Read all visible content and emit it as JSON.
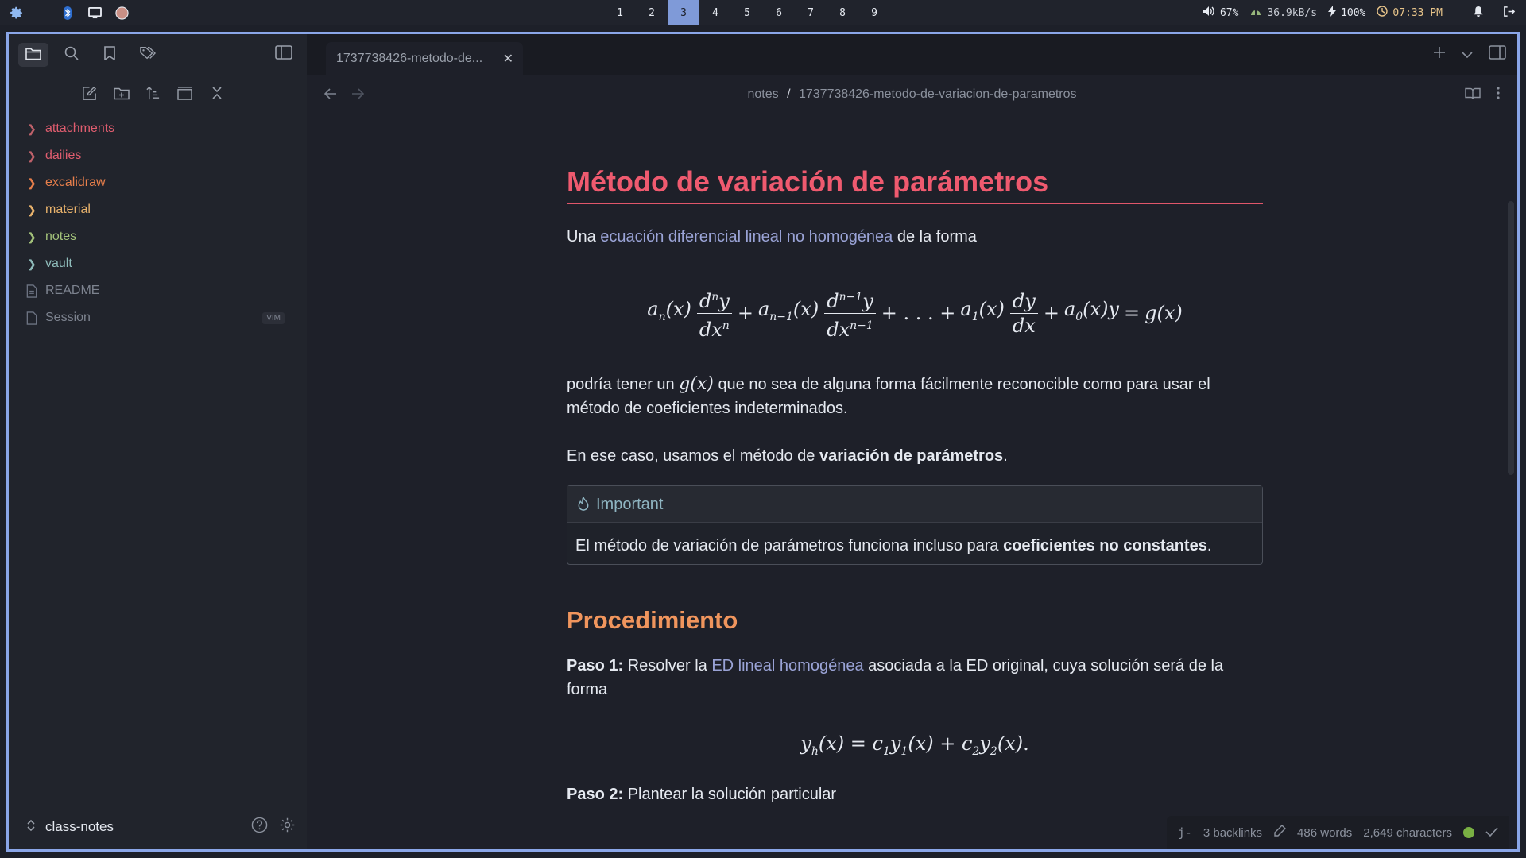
{
  "topbar": {
    "workspaces": [
      "1",
      "2",
      "3",
      "4",
      "5",
      "6",
      "7",
      "8",
      "9"
    ],
    "active_workspace": "3",
    "volume": "67%",
    "network": "36.9kB/s",
    "battery": "100%",
    "clock": "07:33 PM",
    "icons": [
      "gear-icon",
      "bluetooth-icon",
      "monitor-icon",
      "record-icon",
      "volume-icon",
      "network-icon",
      "bolt-icon",
      "clock-icon",
      "bell-icon",
      "logout-icon"
    ]
  },
  "sidebar": {
    "folders": [
      {
        "label": "attachments",
        "color": "#e05d6f"
      },
      {
        "label": "dailies",
        "color": "#e05d6f"
      },
      {
        "label": "excalidraw",
        "color": "#e87f4b"
      },
      {
        "label": "material",
        "color": "#e8b26c"
      },
      {
        "label": "notes",
        "color": "#a3c27a"
      },
      {
        "label": "vault",
        "color": "#8fbcbb"
      }
    ],
    "files": [
      {
        "label": "README",
        "badge": ""
      },
      {
        "label": "Session",
        "badge": "VIM"
      }
    ],
    "vault_name": "class-notes"
  },
  "tab": {
    "title": "1737738426-metodo-de..."
  },
  "breadcrumb": {
    "folder": "notes",
    "sep": "/",
    "file": "1737738426-metodo-de-variacion-de-parametros"
  },
  "doc": {
    "title": "Método de variación de parámetros",
    "p1_pre": "Una",
    "p1_link": "ecuación diferencial lineal no homogénea",
    "p1_post": "de la forma",
    "p2_pre": "podría tener un",
    "p2_math": "g(x)",
    "p2_post": "que no sea de alguna forma fácilmente reconocible como para usar el método de coeficientes indeterminados.",
    "p3_pre": "En ese caso, usamos el método de",
    "p3_bold": "variación de parámetros",
    "p3_post": ".",
    "callout_title": "Important",
    "callout_pre": "El método de variación de parámetros funciona incluso para",
    "callout_bold": "coeficientes no constantes",
    "callout_post": ".",
    "h2": "Procedimiento",
    "step1_label": "Paso 1:",
    "step1_pre": "Resolver la",
    "step1_link": "ED lineal homogénea",
    "step1_post": "asociada a la ED original, cuya solución será de la forma",
    "step2_label": "Paso 2:",
    "step2_text": "Plantear la solución particular"
  },
  "status": {
    "backlinks": "3 backlinks",
    "words": "486 words",
    "chars": "2,649 characters",
    "sync_color": "#79b043"
  }
}
